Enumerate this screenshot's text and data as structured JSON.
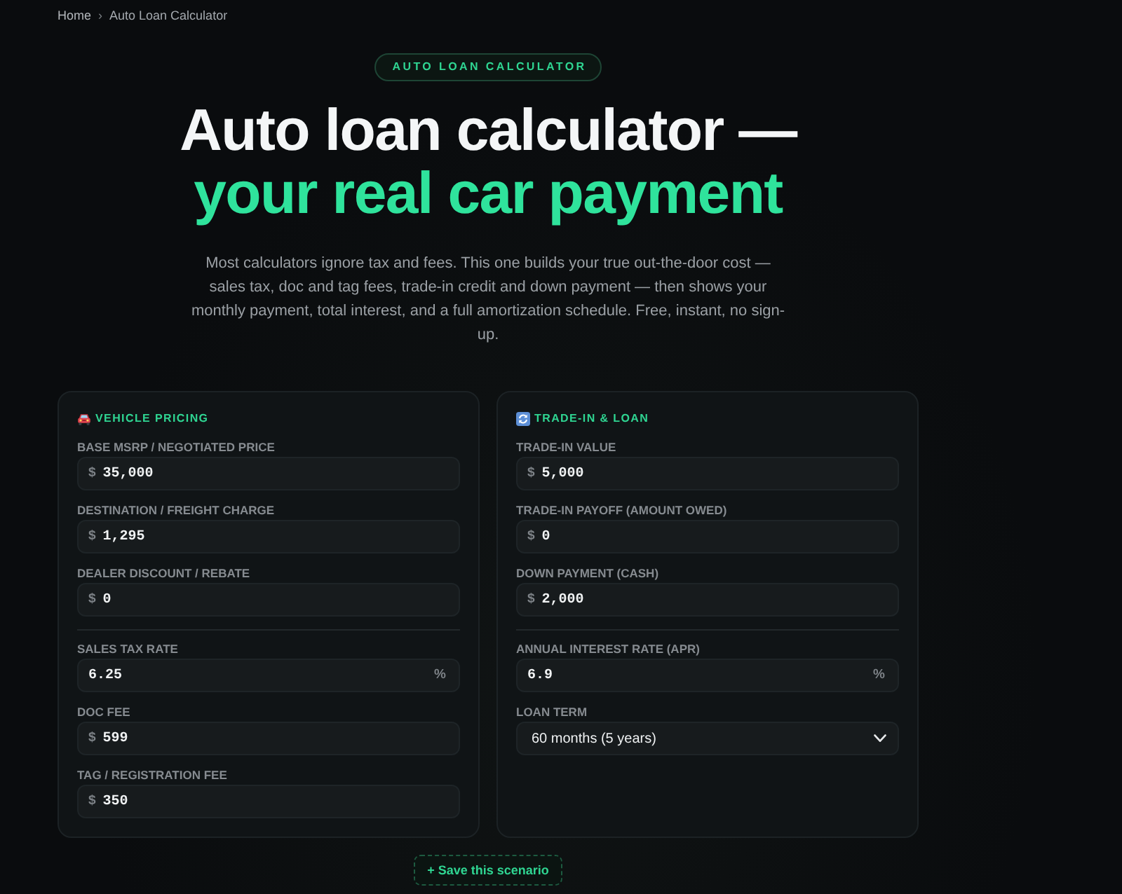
{
  "breadcrumb": {
    "items": [
      {
        "label": "Home"
      },
      {
        "label": "Auto Loan Calculator"
      }
    ],
    "separator": "›"
  },
  "badge": "AUTO LOAN CALCULATOR",
  "heading": {
    "text": "Auto loan calculator —",
    "highlight": "your real car payment"
  },
  "intro": "Most calculators ignore tax and fees. This one builds your true out-the-door cost — sales tax, doc and tag fees, trade-in credit and down payment — then shows your monthly payment, total interest, and a full amortization schedule. Free, instant, no sign-up.",
  "panels": [
    {
      "title": "VEHICLE PRICING",
      "groups": [
        [
          {
            "kind": "input",
            "label": "BASE MSRP / NEGOTIATED PRICE",
            "prefix": "$",
            "value": "35,000"
          },
          {
            "kind": "input",
            "label": "DESTINATION / FREIGHT CHARGE",
            "prefix": "$",
            "value": "1,295"
          },
          {
            "kind": "input",
            "label": "DEALER DISCOUNT / REBATE",
            "prefix": "$",
            "value": "0"
          }
        ],
        [
          {
            "kind": "input",
            "label": "SALES TAX RATE",
            "suffix": "%",
            "value": "6.25"
          },
          {
            "kind": "input",
            "label": "DOC FEE",
            "prefix": "$",
            "value": "599"
          },
          {
            "kind": "input",
            "label": "TAG / REGISTRATION FEE",
            "prefix": "$",
            "value": "350"
          }
        ]
      ]
    },
    {
      "title": "TRADE-IN & LOAN",
      "groups": [
        [
          {
            "kind": "input",
            "label": "TRADE-IN VALUE",
            "prefix": "$",
            "value": "5,000"
          },
          {
            "kind": "input",
            "label": "TRADE-IN PAYOFF (AMOUNT OWED)",
            "prefix": "$",
            "value": "0"
          },
          {
            "kind": "input",
            "label": "DOWN PAYMENT (CASH)",
            "prefix": "$",
            "value": "2,000"
          }
        ],
        [
          {
            "kind": "input",
            "label": "ANNUAL INTEREST RATE (APR)",
            "suffix": "%",
            "value": "6.9"
          },
          {
            "kind": "select",
            "label": "LOAN TERM",
            "value": "60 months (5 years)"
          }
        ]
      ]
    }
  ],
  "save_button": "+ Save this scenario"
}
